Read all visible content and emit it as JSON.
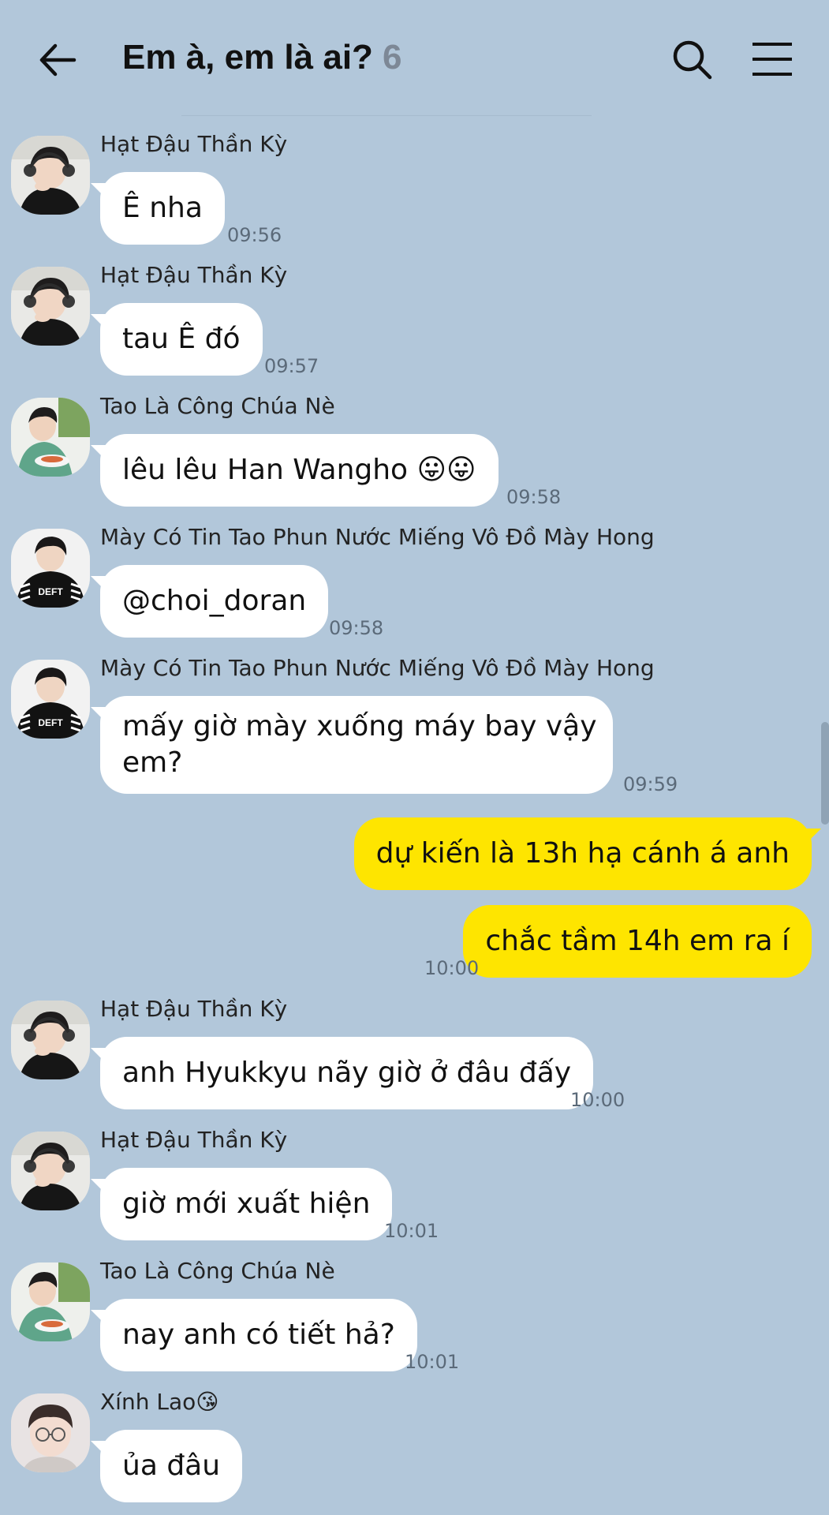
{
  "header": {
    "title": "Em à, em là ai?",
    "member_count": "6",
    "back_icon": "arrow-left-icon",
    "search_icon": "search-icon",
    "menu_icon": "hamburger-menu-icon"
  },
  "colors": {
    "background": "#b2c7da",
    "incoming_bubble": "#ffffff",
    "outgoing_bubble": "#fee500",
    "time_text": "#5b6a79"
  },
  "messages": [
    {
      "sender": "Hạt Đậu Thần Kỳ",
      "text": "Ê nha",
      "time": "09:56",
      "direction": "in"
    },
    {
      "sender": "Hạt Đậu Thần Kỳ",
      "text": "tau Ê đó",
      "time": "09:57",
      "direction": "in"
    },
    {
      "sender": "Tao Là Công Chúa Nè",
      "text": "lêu lêu Han Wangho 😛😛",
      "time": "09:58",
      "direction": "in"
    },
    {
      "sender": "Mày Có Tin Tao Phun Nước Miếng Vô Đồ Mày Hong",
      "text": "@choi_doran",
      "time": "09:58",
      "direction": "in"
    },
    {
      "sender": "Mày Có Tin Tao Phun Nước Miếng Vô Đồ Mày Hong",
      "text_line1": "mấy giờ mày xuống máy bay vậy",
      "text_line2": "em?",
      "time": "09:59",
      "direction": "in"
    },
    {
      "text": "dự kiến là 13h hạ cánh á anh",
      "direction": "out"
    },
    {
      "text": "chắc tầm 14h em ra í",
      "time": "10:00",
      "direction": "out"
    },
    {
      "sender": "Hạt Đậu Thần Kỳ",
      "text": "anh Hyukkyu nãy giờ ở đâu đấy",
      "time": "10:00",
      "direction": "in"
    },
    {
      "sender": "Hạt Đậu Thần Kỳ",
      "text": "giờ mới xuất hiện",
      "time": "10:01",
      "direction": "in"
    },
    {
      "sender": "Tao Là Công Chúa Nè",
      "text": "nay anh có tiết hả?",
      "time": "10:01",
      "direction": "in"
    },
    {
      "sender": "Xính Lao😘",
      "text": "ủa đâu",
      "direction": "in"
    }
  ],
  "avatars": {
    "hat_dau": "avatar-headphones-icon",
    "cong_chua": "avatar-eating-icon",
    "may_co_tin": "avatar-deft-jacket-icon",
    "xinh_lao": "avatar-glasses-icon",
    "deft_jacket_text": "DEFT"
  }
}
